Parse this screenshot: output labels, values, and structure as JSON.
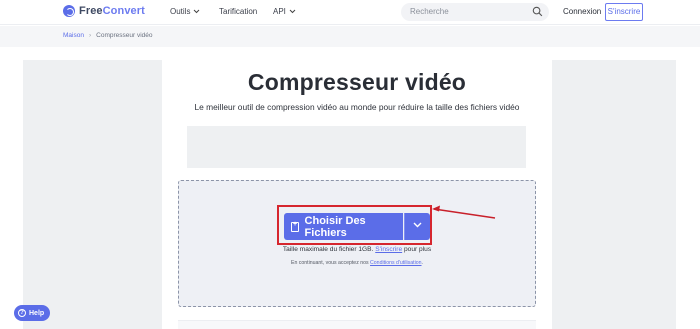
{
  "header": {
    "logo": {
      "part1": "Free",
      "part2": "Convert"
    },
    "nav": [
      {
        "label": "Outils",
        "has_dropdown": true
      },
      {
        "label": "Tarification",
        "has_dropdown": false
      },
      {
        "label": "API",
        "has_dropdown": true
      }
    ],
    "search": {
      "placeholder": "Recherche"
    },
    "login_label": "Connexion",
    "signup_label": "S'inscrire"
  },
  "breadcrumb": {
    "home": "Maison",
    "current": "Compresseur vidéo"
  },
  "main": {
    "title": "Compresseur vidéo",
    "subtitle": "Le meilleur outil de compression vidéo au monde pour réduire la taille des fichiers vidéo"
  },
  "upload": {
    "choose_label": "Choisir Des Fichiers",
    "max_size_text": "Taille maximale du fichier 1GB.",
    "signup_link": "S'inscrire",
    "max_size_suffix": "pour plus",
    "terms_prefix": "En continuant, vous acceptez nos",
    "terms_link": "Conditions d'utilisation",
    "terms_suffix": "."
  },
  "help": {
    "label": "Help"
  },
  "colors": {
    "accent": "#5b6de8",
    "highlight": "#d6262e"
  }
}
